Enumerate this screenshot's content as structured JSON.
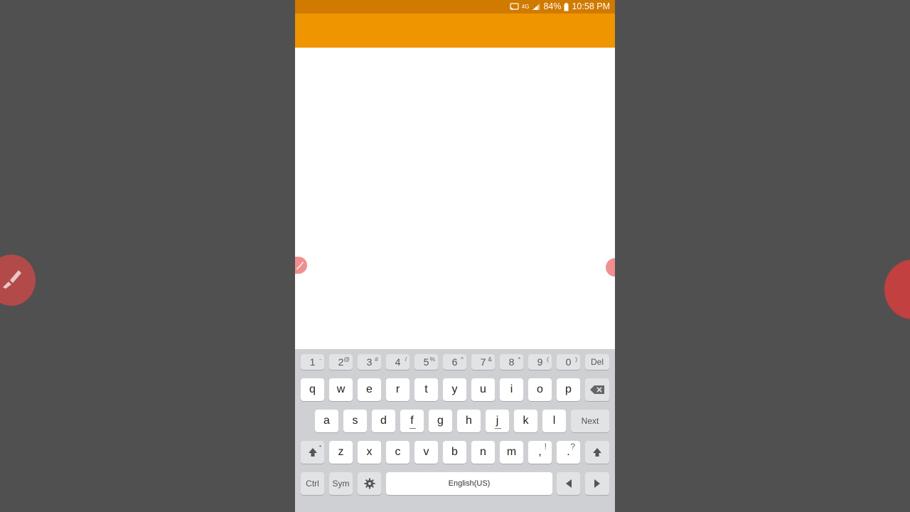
{
  "status_bar": {
    "network_label": "4G",
    "battery_percent": "84%",
    "time": "10:58 PM",
    "icons": [
      "cast-icon",
      "signal-icon",
      "battery-icon"
    ]
  },
  "colors": {
    "status_bar": "#d07a00",
    "app_bar": "#ee9500",
    "fab": "#ef8f8f",
    "keyboard_bg": "#cfd0d3",
    "backdrop": "#505050"
  },
  "keyboard": {
    "number_row": [
      {
        "key": "1",
        "alt": "-"
      },
      {
        "key": "2",
        "alt": "@"
      },
      {
        "key": "3",
        "alt": "#"
      },
      {
        "key": "4",
        "alt": "/"
      },
      {
        "key": "5",
        "alt": "%"
      },
      {
        "key": "6",
        "alt": "^"
      },
      {
        "key": "7",
        "alt": "&"
      },
      {
        "key": "8",
        "alt": "*"
      },
      {
        "key": "9",
        "alt": "("
      },
      {
        "key": "0",
        "alt": ")"
      }
    ],
    "del_label": "Del",
    "row1": [
      "q",
      "w",
      "e",
      "r",
      "t",
      "y",
      "u",
      "i",
      "o",
      "p"
    ],
    "row2": [
      "a",
      "s",
      "d",
      "f",
      "g",
      "h",
      "j",
      "k",
      "l"
    ],
    "next_label": "Next",
    "row3": [
      "z",
      "x",
      "c",
      "v",
      "b",
      "n",
      "m"
    ],
    "comma": {
      "key": ",",
      "alt": "!"
    },
    "period": {
      "key": ".",
      "alt": "?"
    },
    "ctrl_label": "Ctrl",
    "sym_label": "Sym",
    "space_label": "English(US)"
  }
}
